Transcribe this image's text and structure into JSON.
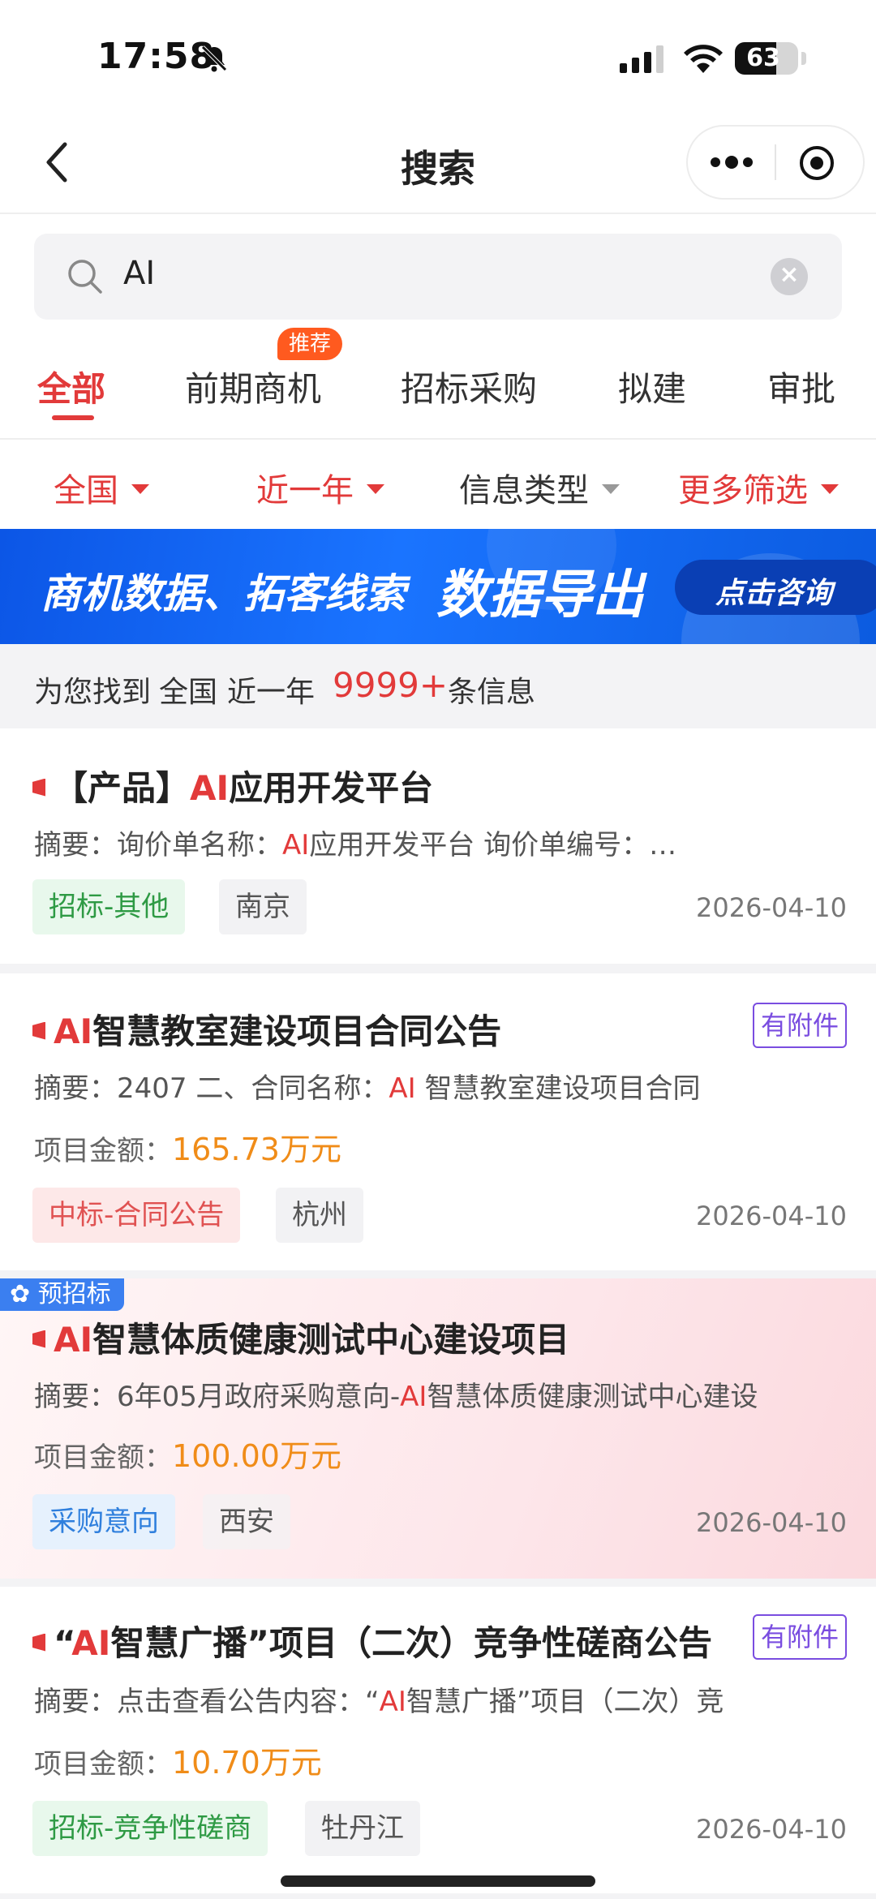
{
  "status": {
    "time": "17:58",
    "battery": "63"
  },
  "nav": {
    "title": "搜索"
  },
  "search": {
    "query": "AI"
  },
  "tabs": [
    {
      "label": "全部",
      "active": true
    },
    {
      "label": "前期商机",
      "badge": "推荐"
    },
    {
      "label": "招标采购"
    },
    {
      "label": "拟建"
    },
    {
      "label": "审批"
    }
  ],
  "filters": [
    {
      "label": "全国",
      "color": "#e23a3a"
    },
    {
      "label": "近一年",
      "color": "#e23a3a"
    },
    {
      "label": "信息类型",
      "color": "#333333"
    },
    {
      "label": "更多筛选",
      "color": "#e23a3a"
    }
  ],
  "banner": {
    "text1": "商机数据、拓客线索",
    "text2": "数据导出",
    "button": "点击咨询"
  },
  "result_summary": {
    "prefix": "为您找到",
    "region": "全国",
    "period": "近一年",
    "count": "9999+",
    "suffix": "条信息"
  },
  "results": [
    {
      "title_pre": "【产品】",
      "title_hl": "AI",
      "title_post": "应用开发平台",
      "summary_label": "摘要：",
      "summary_pre": "询价单名称：",
      "summary_hl": "AI",
      "summary_post": "应用开发平台 询价单编号：…",
      "tag": "招标-其他",
      "city": "南京",
      "date": "2026-04-10"
    },
    {
      "title_pre": "",
      "title_hl": "AI",
      "title_post": "智慧教室建设项目合同公告",
      "attachment": "有附件",
      "summary_label": "摘要：",
      "summary_pre": "2407 二、合同名称：",
      "summary_hl": "AI",
      "summary_post": " 智慧教室建设项目合同",
      "amount_label": "项目金额：",
      "amount": "165.73万元",
      "tag": "中标-合同公告",
      "city": "杭州",
      "date": "2026-04-10"
    },
    {
      "badge": "预招标",
      "title_pre": "",
      "title_hl": "AI",
      "title_post": "智慧体质健康测试中心建设项目",
      "summary_label": "摘要：",
      "summary_pre": "6年05月政府采购意向-",
      "summary_hl": "AI",
      "summary_post": "智慧体质健康测试中心建设",
      "amount_label": "项目金额：",
      "amount": "100.00万元",
      "tag": "采购意向",
      "city": "西安",
      "date": "2026-04-10"
    },
    {
      "title_pre": "“",
      "title_hl": "AI",
      "title_post": "智慧广播”项目（二次）竞争性磋商公告",
      "attachment": "有附件",
      "summary_label": "摘要：",
      "summary_pre": "点击查看公告内容：“",
      "summary_hl": "AI",
      "summary_post": "智慧广播”项目（二次）竞",
      "amount_label": "项目金额：",
      "amount": "10.70万元",
      "tag": "招标-竞争性磋商",
      "city": "牡丹江",
      "date": "2026-04-10"
    }
  ],
  "colors": {
    "accent": "#e23a3a",
    "amount": "#f08c18",
    "banner": "#1a74ff"
  }
}
